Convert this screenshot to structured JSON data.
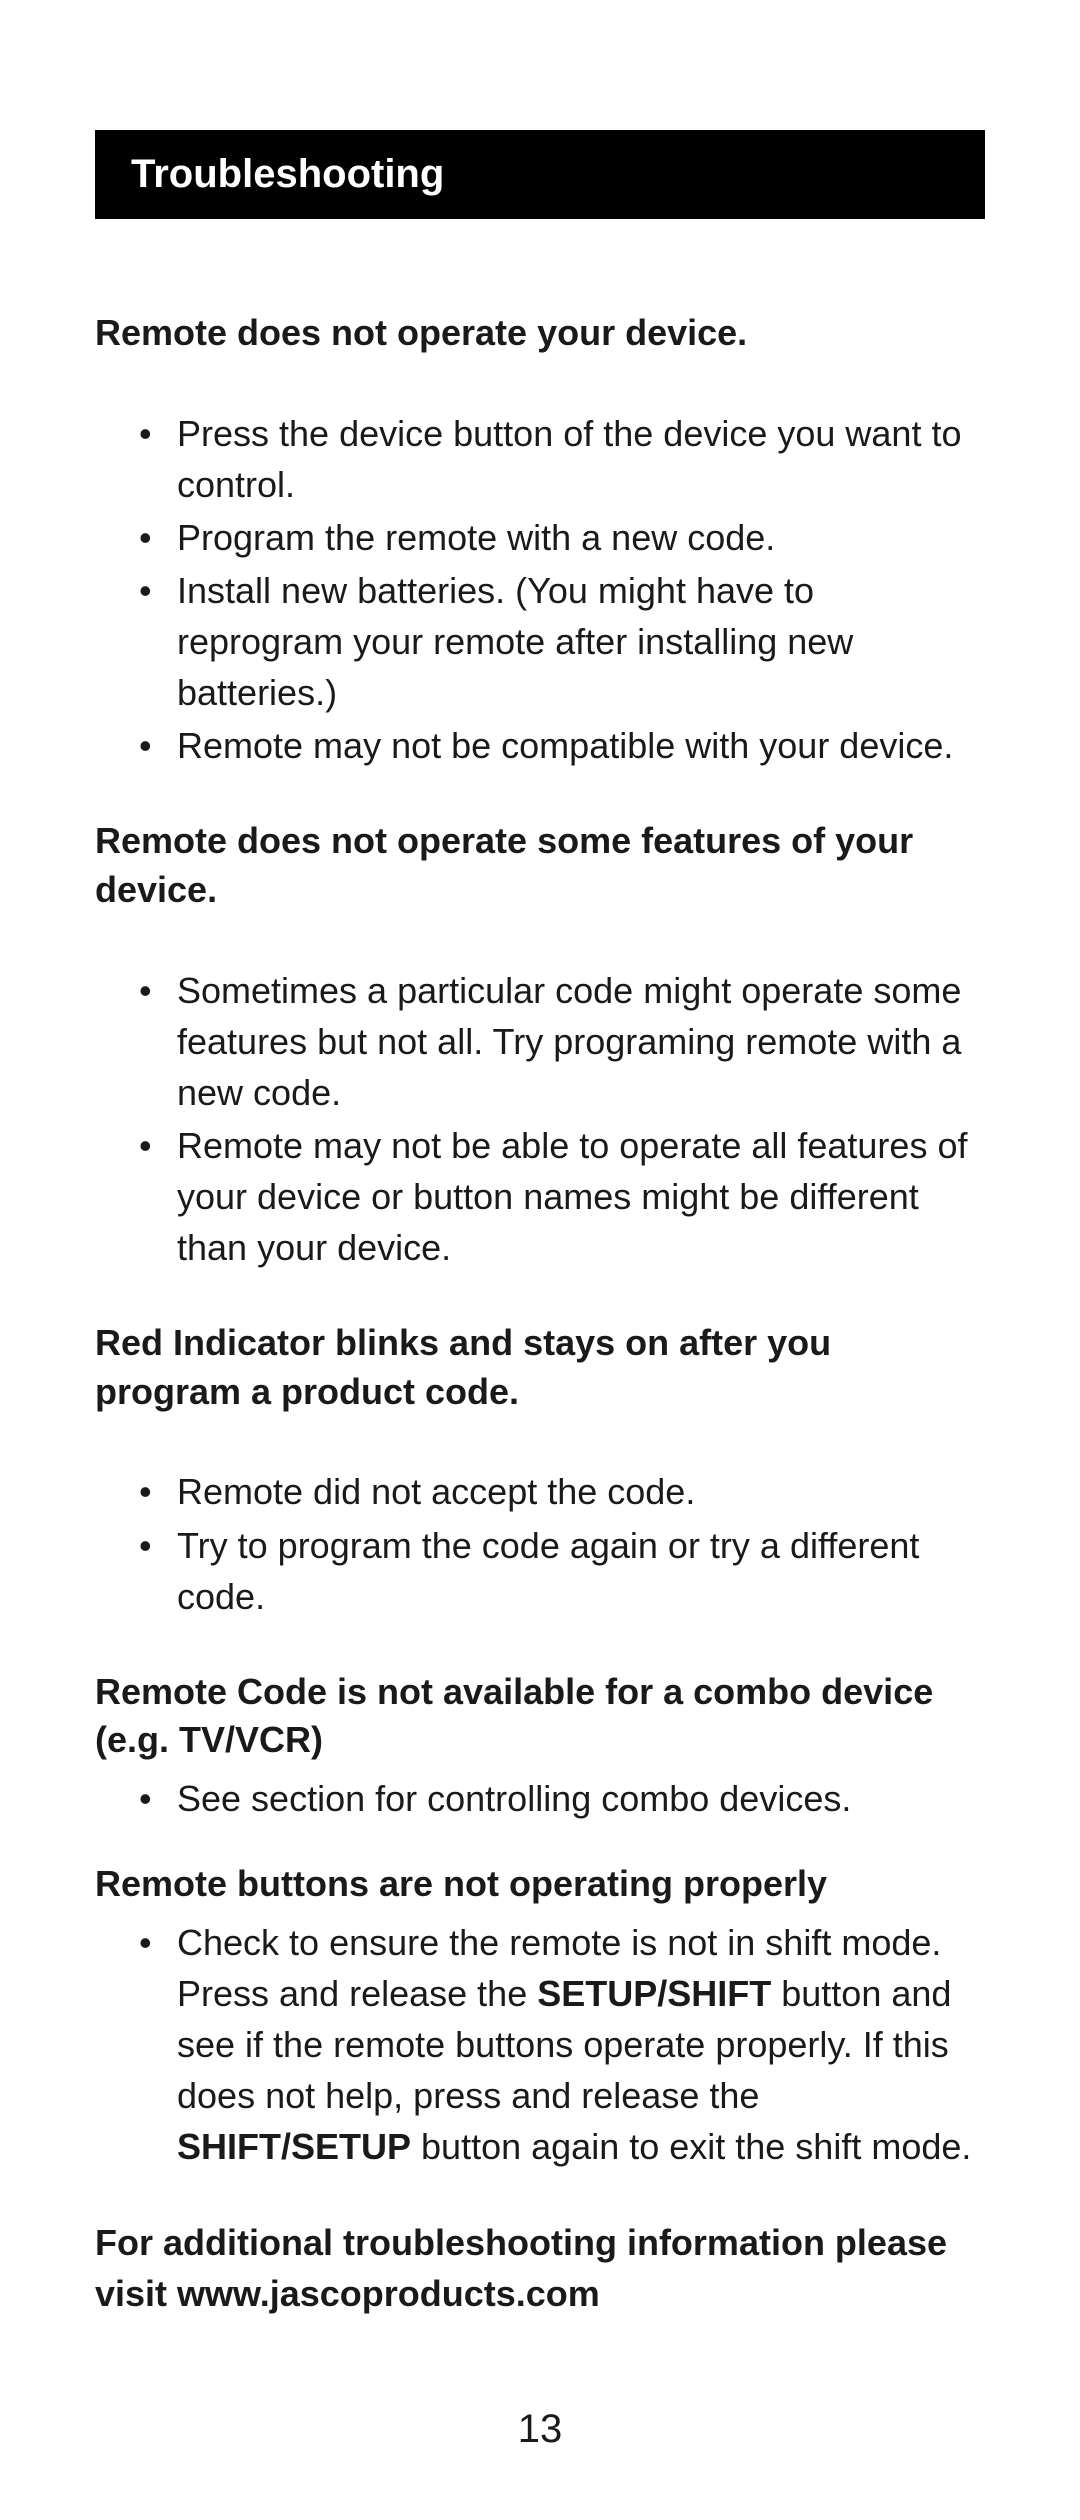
{
  "header": {
    "title": "Troubleshooting"
  },
  "sections": [
    {
      "heading": "Remote does not operate your device.",
      "items": [
        "Press the device button of the device you want to control.",
        "Program the remote with a new code.",
        "Install new batteries. (You might have to reprogram your remote after installing new batteries.)",
        "Remote may not be compatible with your device."
      ]
    },
    {
      "heading": "Remote does not operate some features of  your device.",
      "items": [
        "Sometimes a particular code might operate some features but not all. Try programing remote with a new code.",
        "Remote may not be able to operate all features of your device or button names might be different than your device."
      ]
    },
    {
      "heading": "Red Indicator blinks and stays on after you program a product code.",
      "items": [
        "Remote did not accept the code.",
        "Try to program the code again or try a different code."
      ]
    },
    {
      "heading": "Remote Code is not available for a combo device (e.g. TV/VCR)",
      "items": [
        "See section for controlling combo devices."
      ]
    },
    {
      "heading": "Remote buttons are not operating properly",
      "items_html": [
        "Check to ensure the remote is not in shift mode. Press and release the <span class=\"bold-inline\">SETUP/SHIFT</span> button and see if the remote buttons operate properly. If this does not help, press and release the <span class=\"bold-inline\">SHIFT/SETUP</span> button again to exit the shift mode."
      ]
    }
  ],
  "footer": {
    "text": "For additional troubleshooting information please visit www.jascoproducts.com"
  },
  "page_number": "13"
}
